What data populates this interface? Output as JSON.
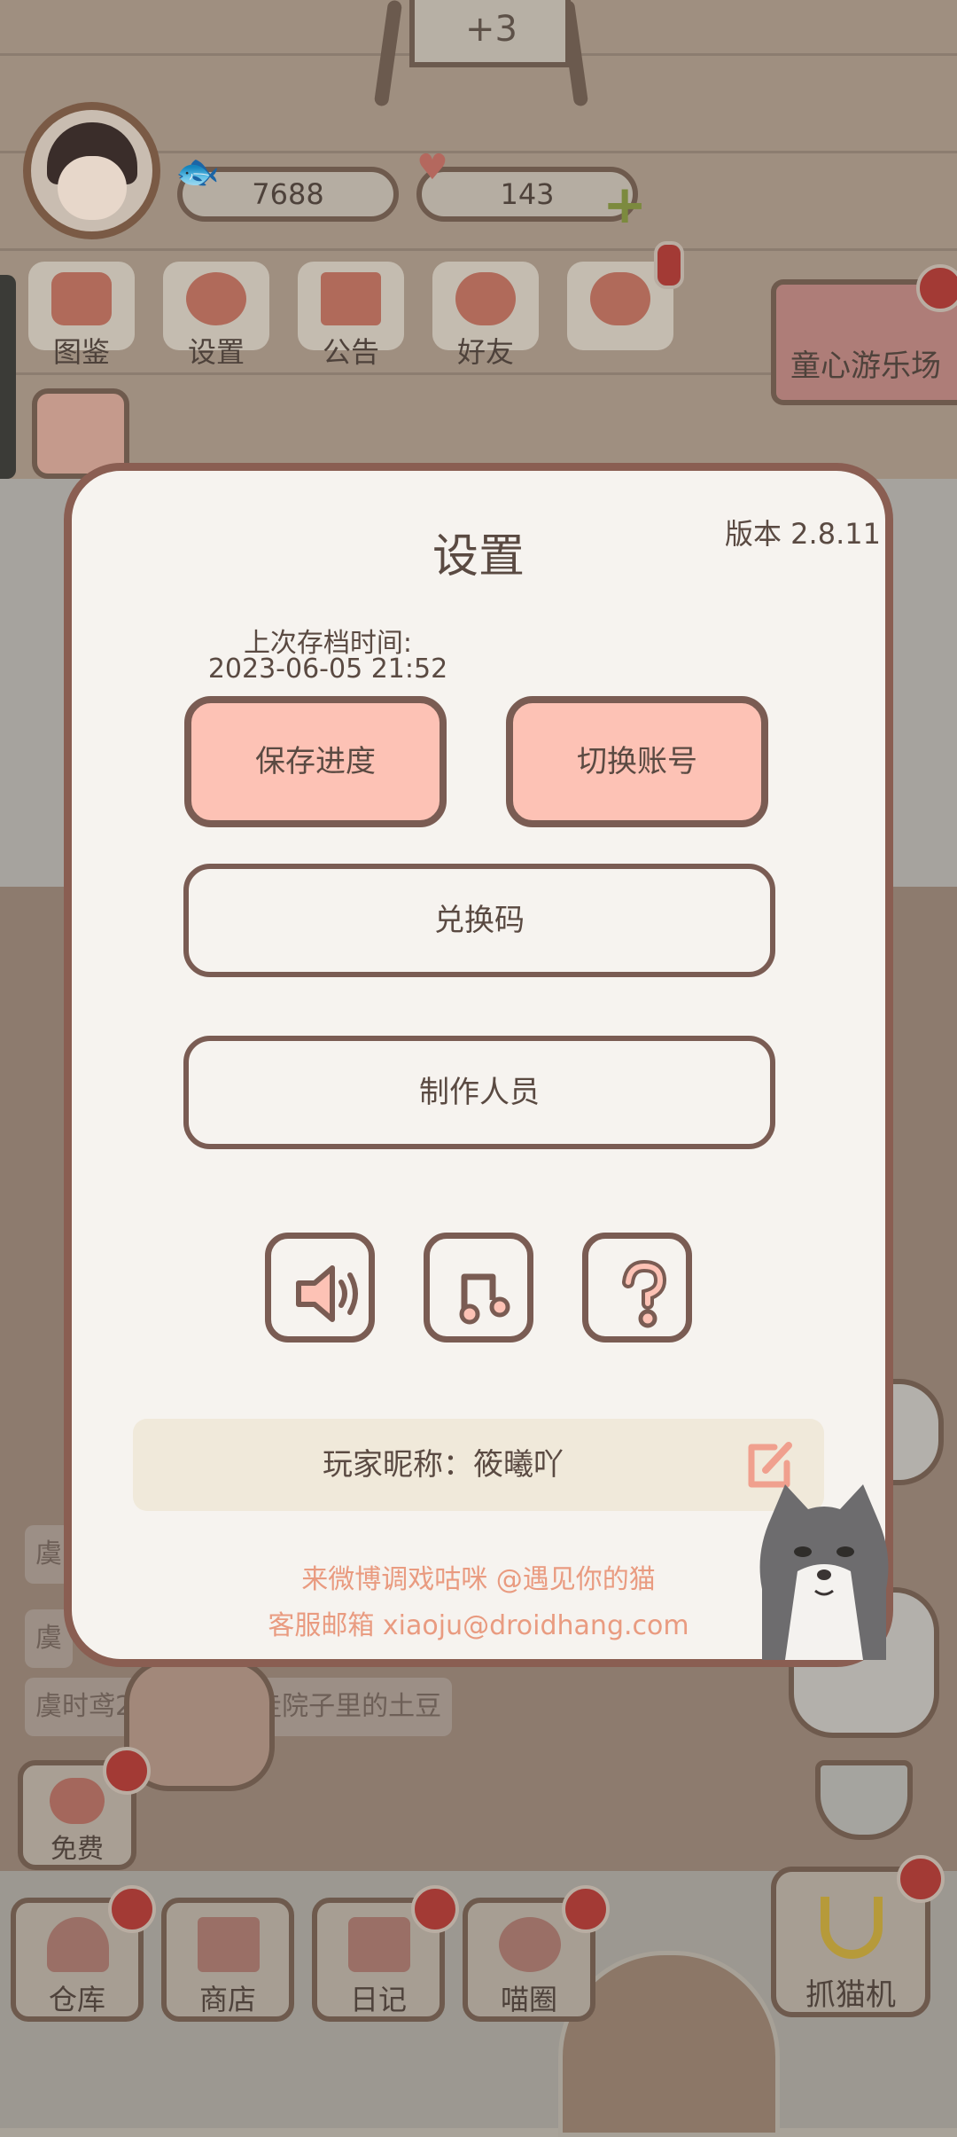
{
  "hud": {
    "fish_count": "7688",
    "heart_count": "143",
    "easel_text": "+3"
  },
  "menu": {
    "items": [
      {
        "label": "图鉴"
      },
      {
        "label": "设置"
      },
      {
        "label": "公告"
      },
      {
        "label": "好友"
      }
    ],
    "banner_label": "童心游乐场"
  },
  "feed": {
    "line1": "虞",
    "line2": "虞",
    "line3": "虞时鸢22小时前拿走院子里的土豆"
  },
  "dock": {
    "free_label": "免费",
    "items": [
      {
        "label": "仓库"
      },
      {
        "label": "商店"
      },
      {
        "label": "日记"
      },
      {
        "label": "喵圈"
      }
    ],
    "claw_label": "抓猫机"
  },
  "settings": {
    "title": "设置",
    "version": "版本 2.8.11",
    "save_time_label": "上次存档时间:",
    "save_time_value": "2023-06-05 21:52",
    "save_button": "保存进度",
    "switch_button": "切换账号",
    "redeem_button": "兑换码",
    "credits_button": "制作人员",
    "icons": [
      "speaker-icon",
      "music-icon",
      "help-icon"
    ],
    "nickname": "玩家昵称：筱曦吖",
    "weibo": "来微博调戏咕咪 @遇见你的猫",
    "email": "客服邮箱 xiaoju@droidhang.com"
  },
  "colors": {
    "accent_pink": "#fdc2b5",
    "border_brown": "#7a5c53",
    "link_orange": "#e99b80",
    "modal_bg": "#f6f3ef",
    "badge_red": "#a33a35"
  }
}
